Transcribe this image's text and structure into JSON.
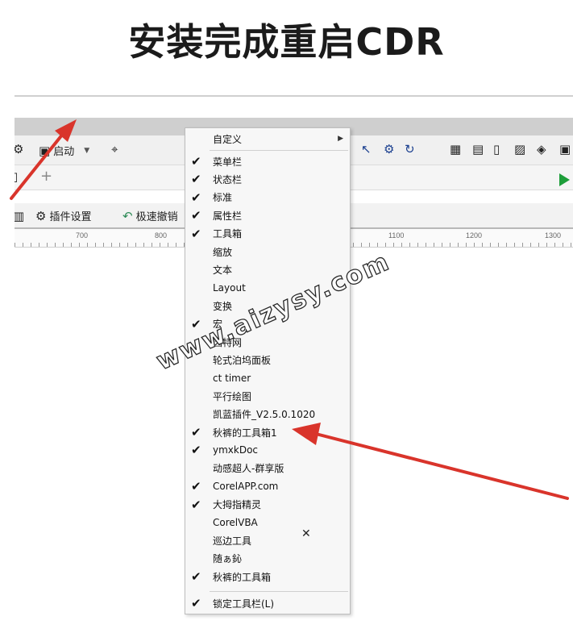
{
  "heading": "安装完成重启CDR",
  "toolbar": {
    "launch_label": "启动",
    "plugin_settings_label": "插件设置",
    "quick_undo_label": "极速撤销",
    "add_tab_label": "+"
  },
  "ruler": {
    "labels": [
      "700",
      "800",
      "1100",
      "1200",
      "1300"
    ]
  },
  "menu": {
    "customize": "自定义",
    "items": [
      {
        "label": "菜单栏",
        "checked": true
      },
      {
        "label": "状态栏",
        "checked": true
      },
      {
        "label": "标准",
        "checked": true
      },
      {
        "label": "属性栏",
        "checked": true
      },
      {
        "label": "工具箱",
        "checked": true
      },
      {
        "label": "缩放",
        "checked": false
      },
      {
        "label": "文本",
        "checked": false
      },
      {
        "label": "Layout",
        "checked": false
      },
      {
        "label": "变换",
        "checked": false
      },
      {
        "label": "宏",
        "checked": true
      },
      {
        "label": "因特网",
        "checked": false
      },
      {
        "label": "轮式泊坞面板",
        "checked": false
      },
      {
        "label": "ct timer",
        "checked": false
      },
      {
        "label": "平行绘图",
        "checked": false
      },
      {
        "label": "凯蓝插件_V2.5.0.1020",
        "checked": false
      },
      {
        "label": "秋裤的工具箱1",
        "checked": true
      },
      {
        "label": "ymxkDoc",
        "checked": true
      },
      {
        "label": "动感超人-群享版",
        "checked": false
      },
      {
        "label": "CorelAPP.com",
        "checked": true
      },
      {
        "label": "大拇指精灵",
        "checked": true
      },
      {
        "label": "CorelVBA",
        "checked": false
      },
      {
        "label": "巡边工具",
        "checked": false
      },
      {
        "label": "随ぁ鈊",
        "checked": false
      },
      {
        "label": "秋裤的工具箱",
        "checked": true
      }
    ],
    "lock_toolbars": "锁定工具栏(L)",
    "lock_checked": true
  },
  "watermark": "www.aizysy.com",
  "check_glyph": "✔",
  "close_glyph": "✕",
  "colors": {
    "arrow": "#d9342b",
    "play": "#1e9e3a"
  }
}
